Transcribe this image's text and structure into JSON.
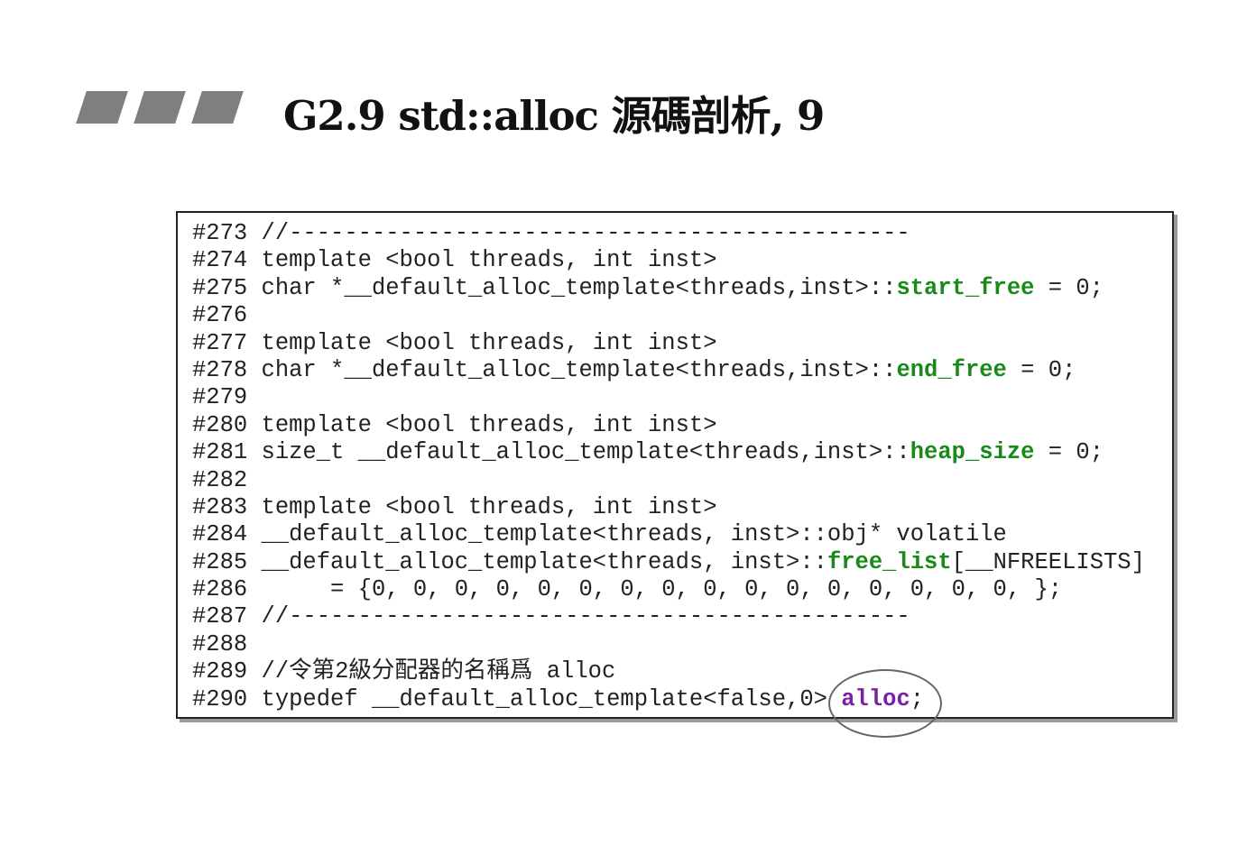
{
  "slide": {
    "title": "G2.9 std::alloc 源碼剖析, 9"
  },
  "code": {
    "lines": [
      {
        "num": "#273",
        "pre": " //---------------------------------------------",
        "hl": "",
        "post": "",
        "hl_color": ""
      },
      {
        "num": "#274",
        "pre": " template <bool threads, int inst>",
        "hl": "",
        "post": "",
        "hl_color": ""
      },
      {
        "num": "#275",
        "pre": " char *__default_alloc_template<threads,inst>::",
        "hl": "start_free",
        "post": " = 0;",
        "hl_color": "green"
      },
      {
        "num": "#276",
        "pre": "",
        "hl": "",
        "post": "",
        "hl_color": ""
      },
      {
        "num": "#277",
        "pre": " template <bool threads, int inst>",
        "hl": "",
        "post": "",
        "hl_color": ""
      },
      {
        "num": "#278",
        "pre": " char *__default_alloc_template<threads,inst>::",
        "hl": "end_free",
        "post": " = 0;",
        "hl_color": "green"
      },
      {
        "num": "#279",
        "pre": "",
        "hl": "",
        "post": "",
        "hl_color": ""
      },
      {
        "num": "#280",
        "pre": " template <bool threads, int inst>",
        "hl": "",
        "post": "",
        "hl_color": ""
      },
      {
        "num": "#281",
        "pre": " size_t __default_alloc_template<threads,inst>::",
        "hl": "heap_size",
        "post": " = 0;",
        "hl_color": "green"
      },
      {
        "num": "#282",
        "pre": "",
        "hl": "",
        "post": "",
        "hl_color": ""
      },
      {
        "num": "#283",
        "pre": " template <bool threads, int inst>",
        "hl": "",
        "post": "",
        "hl_color": ""
      },
      {
        "num": "#284",
        "pre": " __default_alloc_template<threads, inst>::obj* volatile",
        "hl": "",
        "post": "",
        "hl_color": ""
      },
      {
        "num": "#285",
        "pre": " __default_alloc_template<threads, inst>::",
        "hl": "free_list",
        "post": "[__NFREELISTS]",
        "hl_color": "green"
      },
      {
        "num": "#286",
        "pre": "      = {0, 0, 0, 0, 0, 0, 0, 0, 0, 0, 0, 0, 0, 0, 0, 0, };",
        "hl": "",
        "post": "",
        "hl_color": ""
      },
      {
        "num": "#287",
        "pre": " //---------------------------------------------",
        "hl": "",
        "post": "",
        "hl_color": ""
      },
      {
        "num": "#288",
        "pre": "",
        "hl": "",
        "post": "",
        "hl_color": ""
      },
      {
        "num": "#289",
        "pre": " //令第2級分配器的名稱爲 alloc",
        "hl": "",
        "post": "",
        "hl_color": ""
      },
      {
        "num": "#290",
        "pre": " typedef __default_alloc_template<false,0> ",
        "hl": "alloc",
        "post": ";",
        "hl_color": "purple"
      }
    ]
  },
  "colors": {
    "green": "#188a18",
    "purple": "#7a1fa8",
    "title_bars": "#7f7f7f"
  }
}
